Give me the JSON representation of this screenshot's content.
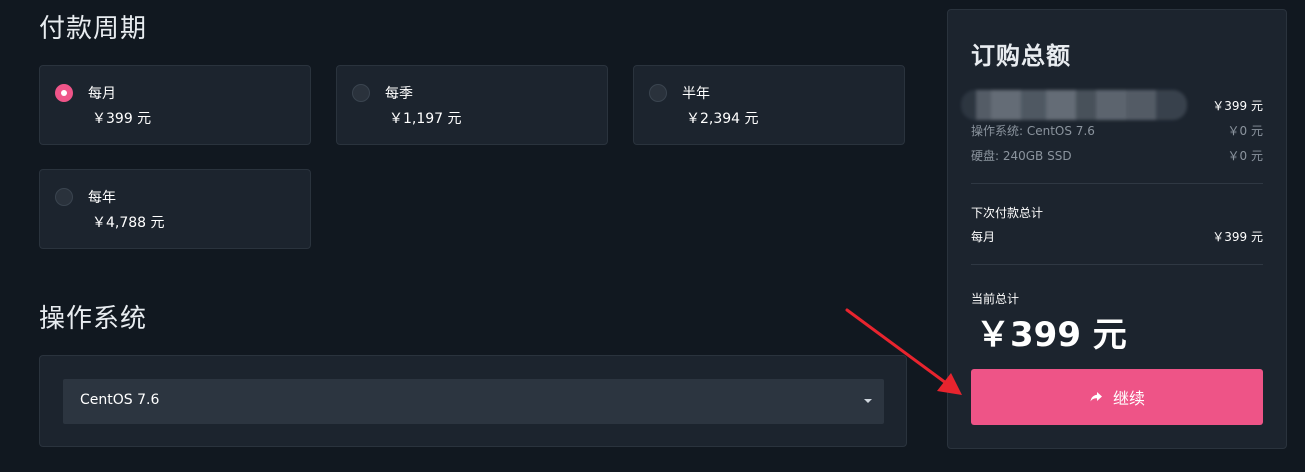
{
  "billing": {
    "title": "付款周期",
    "options": [
      {
        "name": "每月",
        "price": "￥399 元",
        "selected": true
      },
      {
        "name": "每季",
        "price": "￥1,197 元",
        "selected": false
      },
      {
        "name": "半年",
        "price": "￥2,394 元",
        "selected": false
      },
      {
        "name": "每年",
        "price": "￥4,788 元",
        "selected": false
      }
    ]
  },
  "os": {
    "title": "操作系统",
    "selected": "CentOS 7.6"
  },
  "summary": {
    "title": "订购总额",
    "product_price": "￥399 元",
    "lines": [
      {
        "label": "操作系统: CentOS 7.6",
        "value": "￥0 元"
      },
      {
        "label": "硬盘: 240GB SSD",
        "value": "￥0 元"
      }
    ],
    "next_payment_label": "下次付款总计",
    "next_payment_cycle": "每月",
    "next_payment_value": "￥399 元",
    "current_total_label": "当前总计",
    "current_total": "￥399 元",
    "continue_label": "继续"
  },
  "colors": {
    "accent": "#ee5487",
    "background": "#111820",
    "panel": "#1c242e",
    "annotation_arrow": "#e8242e"
  },
  "icons": {
    "radio_selected": "radio-checked-icon",
    "radio_unselected": "radio-unchecked-icon",
    "dropdown": "caret-down-icon",
    "continue": "share-arrow-icon"
  }
}
